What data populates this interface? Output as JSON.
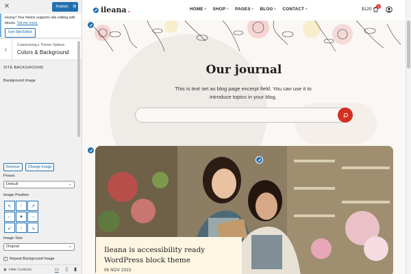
{
  "customizer": {
    "publish_label": "Publish",
    "notice_text": "Hurray! Your theme supports site editing with blocks.",
    "notice_link": "Tell me more.",
    "site_editor_button": "Use Site Editor",
    "breadcrumb": "Customizing ▸ Theme Options",
    "section_title": "Colors & Background",
    "site_background_heading": "Site Background",
    "background_image_label": "Background Image",
    "remove_button": "Remove",
    "change_image_button": "Change Image",
    "preset_label": "Preset",
    "preset_value": "Default",
    "image_position_label": "Image Position",
    "position_arrows": [
      "↖",
      "↑",
      "↗",
      "←",
      "●",
      "→",
      "↙",
      "↓",
      "↘"
    ],
    "image_size_label": "Image Size",
    "image_size_value": "Original",
    "repeat_label": "Repeat Background Image",
    "hide_controls_label": "Hide Controls"
  },
  "site": {
    "logo_text": "ileana",
    "logo_dot": ".",
    "nav": [
      {
        "label": "HOME",
        "has_sub": true
      },
      {
        "label": "SHOP",
        "has_sub": true
      },
      {
        "label": "PAGES",
        "has_sub": true
      },
      {
        "label": "BLOG",
        "has_sub": true
      },
      {
        "label": "CONTACT",
        "has_sub": true
      }
    ],
    "cart_total": "$120",
    "cart_count": "1",
    "journal_title": "Our journal",
    "journal_desc": "This is text set as blog page excerpt field. You can use it to introduce topics in your blog.",
    "search_placeholder": "",
    "post_title": "Ileana is accessibility ready WordPress block theme",
    "post_date": "06 NOV 2023"
  },
  "colors": {
    "accent_blue": "#2271b1",
    "brand_red": "#d4301f",
    "card_cream": "#fdf6e3"
  }
}
